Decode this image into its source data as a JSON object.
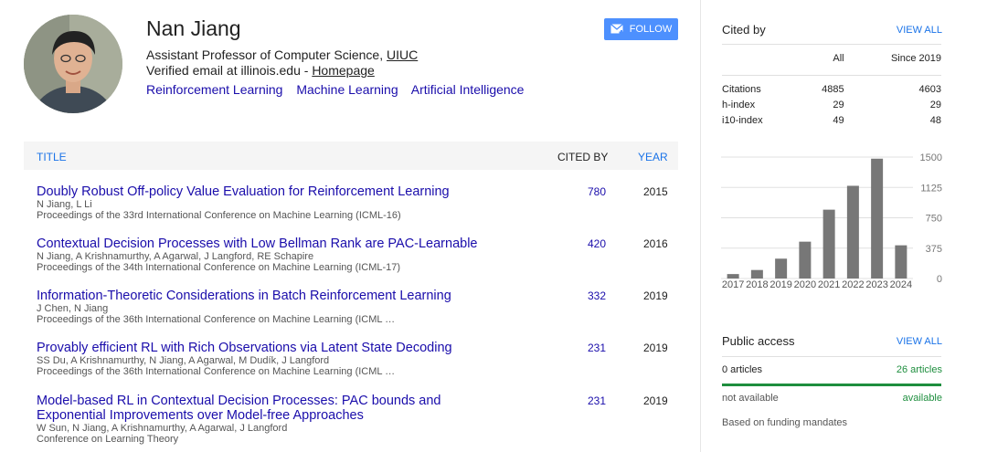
{
  "profile": {
    "name": "Nan Jiang",
    "affiliation_prefix": "Assistant Professor of Computer Science, ",
    "affiliation_link": "UIUC",
    "email_prefix": "Verified email at illinois.edu - ",
    "email_link": "Homepage",
    "interests": [
      "Reinforcement Learning",
      "Machine Learning",
      "Artificial Intelligence"
    ],
    "follow_label": "FOLLOW"
  },
  "table": {
    "headers": {
      "title": "TITLE",
      "cited_by": "CITED BY",
      "year": "YEAR"
    },
    "rows": [
      {
        "title": "Doubly Robust Off-policy Value Evaluation for Reinforcement Learning",
        "authors": "N Jiang, L Li",
        "venue": "Proceedings of the 33rd International Conference on Machine Learning (ICML-16)",
        "cited": "780",
        "year": "2015"
      },
      {
        "title": "Contextual Decision Processes with Low Bellman Rank are PAC-Learnable",
        "authors": "N Jiang, A Krishnamurthy, A Agarwal, J Langford, RE Schapire",
        "venue": "Proceedings of the 34th International Conference on Machine Learning (ICML-17)",
        "cited": "420",
        "year": "2016"
      },
      {
        "title": "Information-Theoretic Considerations in Batch Reinforcement Learning",
        "authors": "J Chen, N Jiang",
        "venue": "Proceedings of the 36th International Conference on Machine Learning (ICML …",
        "cited": "332",
        "year": "2019"
      },
      {
        "title": "Provably efficient RL with Rich Observations via Latent State Decoding",
        "authors": "SS Du, A Krishnamurthy, N Jiang, A Agarwal, M Dudík, J Langford",
        "venue": "Proceedings of the 36th International Conference on Machine Learning (ICML …",
        "cited": "231",
        "year": "2019"
      },
      {
        "title": "Model-based RL in Contextual Decision Processes: PAC bounds and Exponential Improvements over Model-free Approaches",
        "authors": "W Sun, N Jiang, A Krishnamurthy, A Agarwal, J Langford",
        "venue": "Conference on Learning Theory",
        "cited": "231",
        "year": "2019"
      }
    ]
  },
  "cited_by": {
    "title": "Cited by",
    "view_all": "VIEW ALL",
    "col_all": "All",
    "col_since": "Since 2019",
    "rows": [
      {
        "label": "Citations",
        "all": "4885",
        "since": "4603"
      },
      {
        "label": "h-index",
        "all": "29",
        "since": "29"
      },
      {
        "label": "i10-index",
        "all": "49",
        "since": "48"
      }
    ]
  },
  "chart_data": {
    "type": "bar",
    "categories": [
      "2017",
      "2018",
      "2019",
      "2020",
      "2021",
      "2022",
      "2023",
      "2024"
    ],
    "values": [
      55,
      105,
      245,
      455,
      850,
      1145,
      1480,
      410
    ],
    "ylim": [
      0,
      1500
    ],
    "yticks": [
      "1500",
      "1125",
      "750",
      "375",
      "0"
    ],
    "bar_color": "#777777",
    "grid": true
  },
  "public_access": {
    "title": "Public access",
    "view_all": "VIEW ALL",
    "left_count": "0 articles",
    "right_count": "26 articles",
    "left_status": "not available",
    "right_status": "available",
    "note": "Based on funding mandates",
    "available_fraction": 1.0
  }
}
